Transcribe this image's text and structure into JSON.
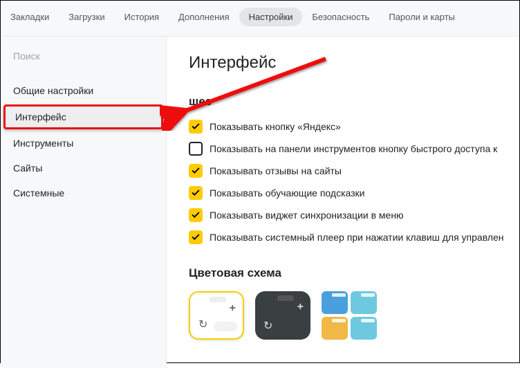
{
  "topnav": {
    "tabs": [
      {
        "label": "Закладки"
      },
      {
        "label": "Загрузки"
      },
      {
        "label": "История"
      },
      {
        "label": "Дополнения"
      },
      {
        "label": "Настройки",
        "active": true
      },
      {
        "label": "Безопасность"
      },
      {
        "label": "Пароли и карты"
      }
    ]
  },
  "sidebar": {
    "search_placeholder": "Поиск",
    "items": [
      {
        "label": "Общие настройки"
      },
      {
        "label": "Интерфейс",
        "highlight": true
      },
      {
        "label": "Инструменты"
      },
      {
        "label": "Сайты"
      },
      {
        "label": "Системные"
      }
    ]
  },
  "content": {
    "page_title": "Интерфейс",
    "section_general": "щее",
    "options": [
      {
        "checked": true,
        "label": "Показывать кнопку «Яндекс»"
      },
      {
        "checked": false,
        "label": "Показывать на панели инструментов кнопку быстрого доступа к"
      },
      {
        "checked": true,
        "label": "Показывать отзывы на сайты"
      },
      {
        "checked": true,
        "label": "Показывать обучающие подсказки"
      },
      {
        "checked": true,
        "label": "Показывать виджет синхронизации в меню"
      },
      {
        "checked": true,
        "label": "Показывать системный плеер при нажатии клавиш для управлен"
      }
    ],
    "section_color": "Цветовая схема"
  }
}
